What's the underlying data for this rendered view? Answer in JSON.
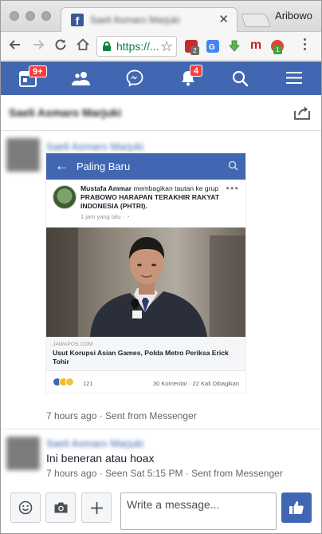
{
  "browser": {
    "tab_title": "Saeli Asmaro Marjuki",
    "profile_name": "Aribowo",
    "url": "https://...",
    "extensions": [
      {
        "name": "lastpass-extension",
        "badge": "2",
        "color": "#c92a2a"
      },
      {
        "name": "translate-extension",
        "badge": "",
        "color": "#4285f4"
      },
      {
        "name": "download-extension",
        "badge": "",
        "color": "#4caf50"
      },
      {
        "name": "mendeley-extension",
        "badge": "",
        "color": "#d71920"
      },
      {
        "name": "adblock-extension",
        "badge": "1",
        "color": "#e0452b"
      }
    ]
  },
  "fb_nav": {
    "home_badge": "9+",
    "notifications_badge": "4",
    "color": "#4267b2"
  },
  "conversation": {
    "name": "Saeli Asmaro Marjuki"
  },
  "messages": [
    {
      "sender": "Saeli Asmaro Marjuki",
      "attachment": {
        "header_title": "Paling Baru",
        "post_author": "Mustafa Ammar",
        "post_action": " membagikan tautan ke grup ",
        "post_group": "PRABOWO  HARAPAN TERAKHIR RAKYAT INDONESIA (PHTRI).",
        "post_time": "1 jam yang lalu · ",
        "link_domain": "JAWAPOS.COM",
        "link_title": "Usut Korupsi Asian Games, Polda Metro Periksa Erick Tohir",
        "reaction_count": "121",
        "comments": "30 Komentar",
        "shares": "22 Kali Dibagikan"
      },
      "meta": "7 hours ago · Sent from Messenger"
    },
    {
      "sender": "Saeli Asmaro Marjuki",
      "text": "Ini beneran atau hoax",
      "meta": "7 hours ago · Seen Sat 5:15 PM · Sent from Messenger"
    }
  ],
  "composer": {
    "placeholder": "Write a message..."
  }
}
